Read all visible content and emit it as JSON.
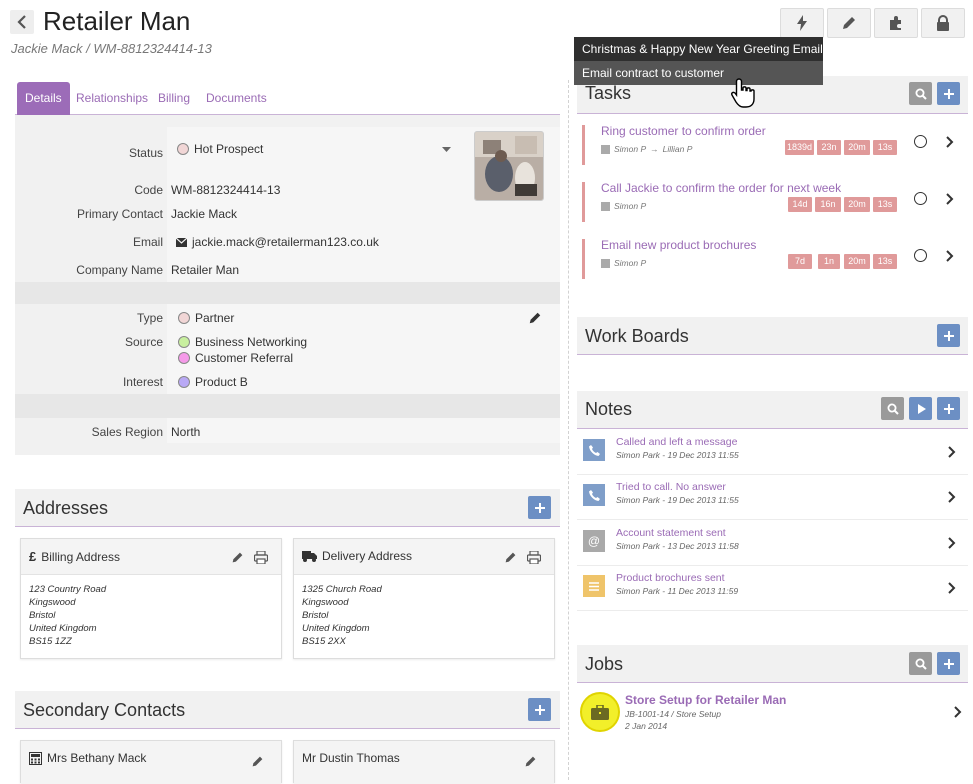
{
  "header": {
    "title": "Retailer Man",
    "subtitle": "Jackie Mack / WM-8812324414-13",
    "toolbar_icons": [
      "lightning-icon",
      "pencil-icon",
      "puzzle-icon",
      "lock-icon"
    ]
  },
  "dropdown": {
    "items": [
      "Christmas & Happy New Year Greeting Email",
      "Email contract to customer"
    ]
  },
  "tabs": [
    "Details",
    "Relationships",
    "Billing",
    "Documents"
  ],
  "details": {
    "status_label": "Status",
    "status_value": "Hot Prospect",
    "code_label": "Code",
    "code_value": "WM-8812324414-13",
    "contact_label": "Primary Contact",
    "contact_value": "Jackie Mack",
    "email_label": "Email",
    "email_value": "jackie.mack@retailerman123.co.uk",
    "company_label": "Company Name",
    "company_value": "Retailer Man",
    "type_label": "Type",
    "type_value": "Partner",
    "source_label": "Source",
    "source_values": [
      "Business Networking",
      "Customer Referral"
    ],
    "interest_label": "Interest",
    "interest_value": "Product B",
    "region_label": "Sales Region",
    "region_value": "North"
  },
  "colors": {
    "accent": "#9c6cb8",
    "blue_button": "#6c8fc4",
    "task_badge": "#e09a9a",
    "dot_partner": "#f1d6d6",
    "dot_networking": "#c8ef9f",
    "dot_referral": "#f59ae9",
    "dot_product": "#b9a9f5"
  },
  "addresses": {
    "title": "Addresses",
    "billing": {
      "title": "Billing Address",
      "lines": [
        "123 Country Road",
        "Kingswood",
        "Bristol",
        "United Kingdom",
        "BS15 1ZZ"
      ]
    },
    "delivery": {
      "title": "Delivery Address",
      "lines": [
        "1325 Church Road",
        "Kingswood",
        "Bristol",
        "United Kingdom",
        "BS15 2XX"
      ]
    }
  },
  "secondary_contacts": {
    "title": "Secondary Contacts",
    "contacts": [
      "Mrs Bethany Mack",
      "Mr Dustin Thomas"
    ]
  },
  "tasks": {
    "title": "Tasks",
    "items": [
      {
        "title": "Ring customer to confirm order",
        "from": "Simon P",
        "arrow": "→",
        "to": "Lillian P",
        "badges": [
          "1839d",
          "23n",
          "20m",
          "13s"
        ]
      },
      {
        "title": "Call Jackie to confirm the order for next week",
        "from": "Simon P",
        "badges": [
          "14d",
          "16n",
          "20m",
          "13s"
        ]
      },
      {
        "title": "Email new product brochures",
        "from": "Simon P",
        "badges": [
          "7d",
          "1n",
          "20m",
          "13s"
        ]
      }
    ]
  },
  "work_boards": {
    "title": "Work Boards"
  },
  "notes": {
    "title": "Notes",
    "items": [
      {
        "title": "Called and left a message",
        "meta": "Simon Park - 19 Dec 2013 11:55",
        "icon": "phone-icon"
      },
      {
        "title": "Tried to call. No answer",
        "meta": "Simon Park - 19 Dec 2013 11:55",
        "icon": "phone-icon"
      },
      {
        "title": "Account statement sent",
        "meta": "Simon Park - 13 Dec 2013 11:58",
        "icon": "at-icon"
      },
      {
        "title": "Product brochures sent",
        "meta": "Simon Park - 11 Dec 2013 11:59",
        "icon": "document-icon"
      }
    ]
  },
  "jobs": {
    "title": "Jobs",
    "items": [
      {
        "title": "Store Setup for Retailer Man",
        "ref": "JB-1001-14 / Store Setup",
        "date": "2 Jan 2014"
      }
    ]
  }
}
